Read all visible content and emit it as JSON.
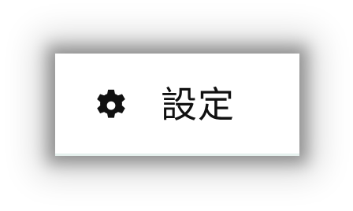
{
  "menu": {
    "items": [
      {
        "label": "設定",
        "icon": "gear-icon"
      }
    ]
  },
  "colors": {
    "text": "#111111",
    "icon": "#111111",
    "card_background": "#ffffff",
    "bottom_accent": "#e6f1ee"
  }
}
